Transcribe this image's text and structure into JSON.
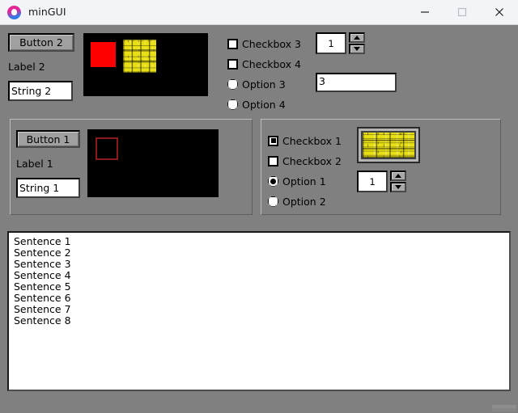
{
  "window": {
    "title": "minGUI",
    "icon": "app-circle-icon",
    "controls": {
      "minimize": "minimize-icon",
      "maximize": "maximize-icon",
      "close": "close-icon"
    },
    "background_color": "#808080",
    "titlebar_color": "#f3f4f8"
  },
  "top_section": {
    "button": {
      "label": "Button 2"
    },
    "label": {
      "text": "Label 2"
    },
    "entry": {
      "value": "String 2"
    },
    "canvas": {
      "name": "image-canvas-2",
      "background_color": "#000000",
      "shapes": [
        {
          "kind": "filled-rect",
          "color": "#ff0000"
        },
        {
          "kind": "texture-brick",
          "color": "#e8e014"
        }
      ]
    },
    "checkboxes": [
      {
        "label": "Checkbox 3",
        "checked": false
      },
      {
        "label": "Checkbox 4",
        "checked": false
      }
    ],
    "radios": [
      {
        "label": "Option 3",
        "selected": false
      },
      {
        "label": "Option 4",
        "selected": false
      }
    ],
    "spinbox": {
      "value": "1"
    },
    "entry_right": {
      "value": "3"
    }
  },
  "group_left": {
    "button": {
      "label": "Button 1"
    },
    "label": {
      "text": "Label 1"
    },
    "entry": {
      "value": "String 1"
    },
    "canvas": {
      "name": "image-canvas-1",
      "background_color": "#000000",
      "shapes": [
        {
          "kind": "outline-rect",
          "color": "#8b1a1a"
        }
      ]
    }
  },
  "group_right": {
    "checkboxes": [
      {
        "label": "Checkbox 1",
        "checked": true
      },
      {
        "label": "Checkbox 2",
        "checked": false
      }
    ],
    "radios": [
      {
        "label": "Option 1",
        "selected": true
      },
      {
        "label": "Option 2",
        "selected": false
      }
    ],
    "texture": {
      "name": "brick-texture-thumbnail",
      "color": "#e8e014"
    },
    "spinbox": {
      "value": "1"
    }
  },
  "textarea": {
    "lines": [
      "Sentence 1",
      "Sentence 2",
      "Sentence 3",
      "Sentence 4",
      "Sentence 5",
      "Sentence 6",
      "Sentence 7",
      "Sentence 8"
    ]
  }
}
